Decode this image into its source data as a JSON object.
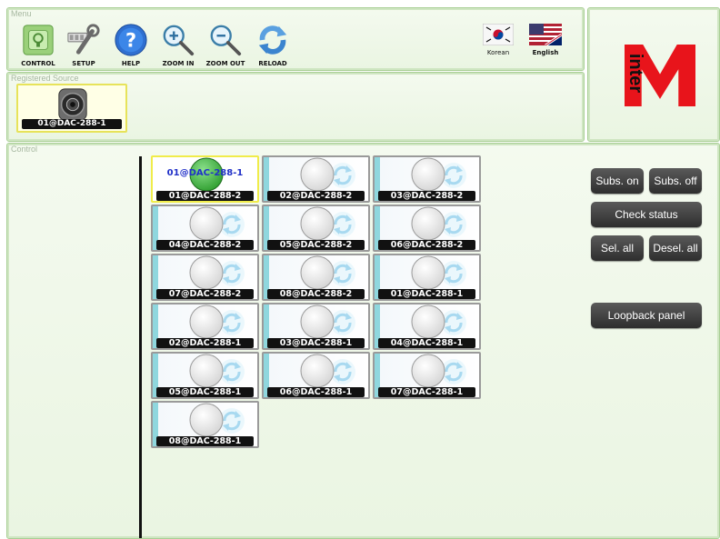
{
  "menu": {
    "title": "Menu",
    "buttons": [
      {
        "label": "CONTROL",
        "icon": "control-icon"
      },
      {
        "label": "SETUP",
        "icon": "setup-icon"
      },
      {
        "label": "HELP",
        "icon": "help-icon"
      },
      {
        "label": "ZOOM IN",
        "icon": "zoom-in-icon"
      },
      {
        "label": "ZOOM OUT",
        "icon": "zoom-out-icon"
      },
      {
        "label": "RELOAD",
        "icon": "reload-icon"
      }
    ],
    "languages": [
      {
        "label": "Korean",
        "icon": "korean-flag-icon"
      },
      {
        "label": "English",
        "icon": "english-flag-icon"
      }
    ]
  },
  "logo": {
    "text": "inter",
    "letter": "M",
    "accent_color": "#e8141b"
  },
  "registered_source": {
    "title": "Registered Source",
    "items": [
      {
        "name": "01@DAC-288-1",
        "icon": "speaker-icon"
      }
    ]
  },
  "control": {
    "title": "Control",
    "selected_source_label": "01@DAC-288-1",
    "tiles": [
      {
        "name": "01@DAC-288-2",
        "state": "selected"
      },
      {
        "name": "02@DAC-288-2",
        "state": "idle"
      },
      {
        "name": "03@DAC-288-2",
        "state": "idle"
      },
      {
        "name": "04@DAC-288-2",
        "state": "idle"
      },
      {
        "name": "05@DAC-288-2",
        "state": "idle"
      },
      {
        "name": "06@DAC-288-2",
        "state": "idle"
      },
      {
        "name": "07@DAC-288-2",
        "state": "idle"
      },
      {
        "name": "08@DAC-288-2",
        "state": "idle"
      },
      {
        "name": "01@DAC-288-1",
        "state": "idle"
      },
      {
        "name": "02@DAC-288-1",
        "state": "idle"
      },
      {
        "name": "03@DAC-288-1",
        "state": "idle"
      },
      {
        "name": "04@DAC-288-1",
        "state": "idle"
      },
      {
        "name": "05@DAC-288-1",
        "state": "idle"
      },
      {
        "name": "06@DAC-288-1",
        "state": "idle"
      },
      {
        "name": "07@DAC-288-1",
        "state": "idle"
      },
      {
        "name": "08@DAC-288-1",
        "state": "idle"
      }
    ],
    "buttons": {
      "subs_on": "Subs. on",
      "subs_off": "Subs. off",
      "check_status": "Check status",
      "sel_all": "Sel. all",
      "desel_all": "Desel. all",
      "loopback_panel": "Loopback panel"
    }
  },
  "colors": {
    "panel_bg": "#eaf5e2",
    "panel_border": "#a9cf95",
    "tile_accent": "#8fd7de",
    "selected_border": "#f0ec4a",
    "active_indicator": "#2e9d2e"
  }
}
